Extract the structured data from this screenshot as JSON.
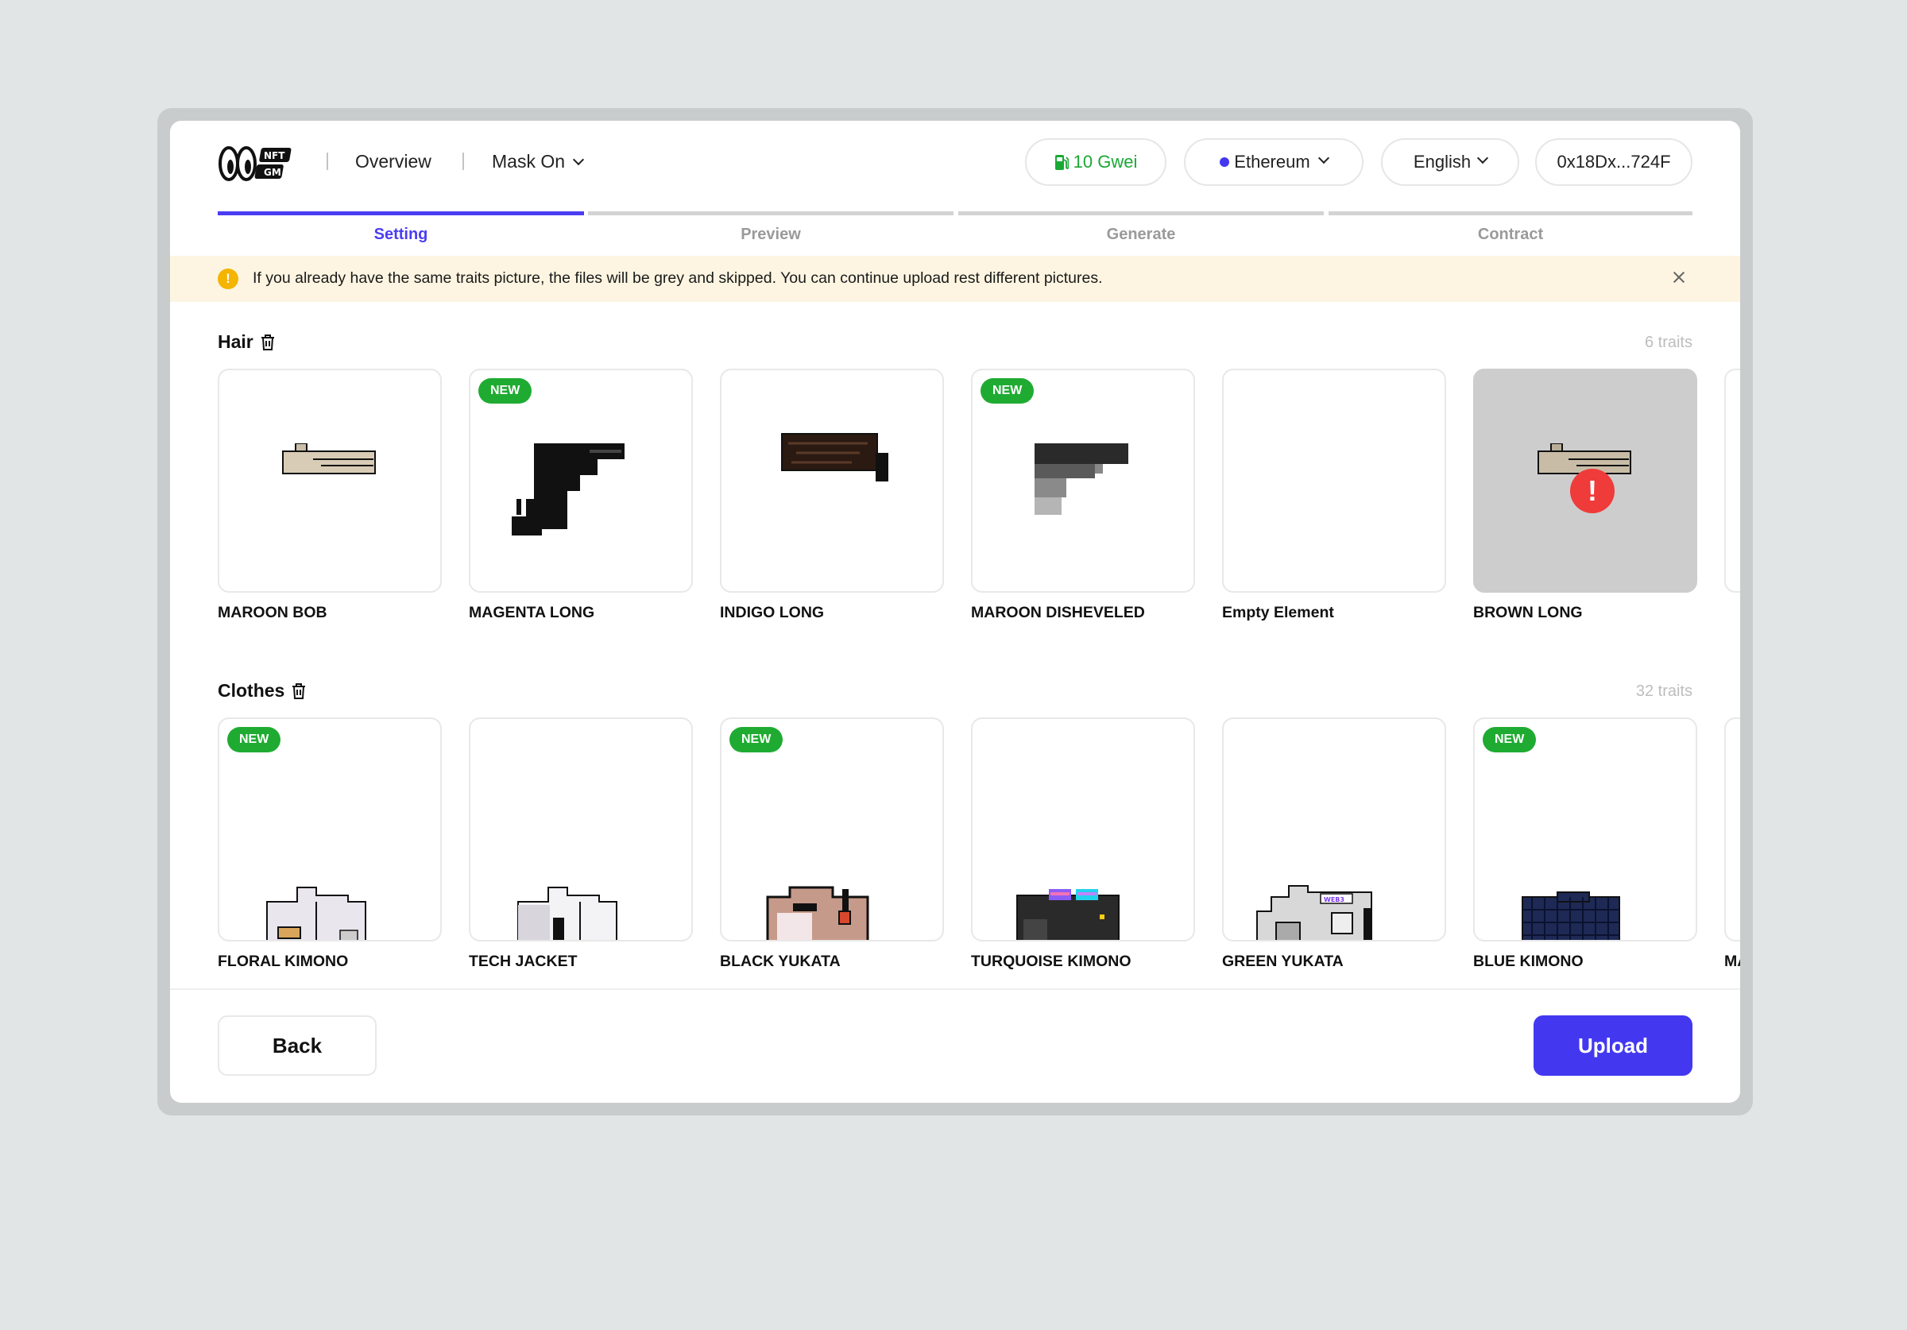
{
  "header": {
    "logo_text": "NFT GM",
    "nav": {
      "overview": "Overview",
      "project": "Mask On"
    },
    "gas": "10 Gwei",
    "network": "Ethereum",
    "language": "English",
    "wallet": "0x18Dx...724F"
  },
  "steps": [
    {
      "label": "Setting",
      "active": true
    },
    {
      "label": "Preview",
      "active": false
    },
    {
      "label": "Generate",
      "active": false
    },
    {
      "label": "Contract",
      "active": false
    }
  ],
  "notice": {
    "text": "If you already have the same traits picture,  the files will be grey and skipped. You can continue upload rest different pictures."
  },
  "sections": [
    {
      "title": "Hair",
      "count": "6 traits",
      "items": [
        {
          "name": "MAROON BOB",
          "badge": ""
        },
        {
          "name": "MAGENTA LONG",
          "badge": "NEW"
        },
        {
          "name": "INDIGO LONG",
          "badge": ""
        },
        {
          "name": "MAROON DISHEVELED",
          "badge": "NEW"
        },
        {
          "name": "Empty Element",
          "badge": ""
        },
        {
          "name": "BROWN LONG",
          "badge": "",
          "duplicate": true
        }
      ]
    },
    {
      "title": "Clothes",
      "count": "32 traits",
      "items": [
        {
          "name": "FLORAL KIMONO",
          "badge": "NEW"
        },
        {
          "name": "TECH JACKET",
          "badge": ""
        },
        {
          "name": "BLACK YUKATA",
          "badge": "NEW"
        },
        {
          "name": "TURQUOISE KIMONO",
          "badge": ""
        },
        {
          "name": "GREEN YUKATA",
          "badge": ""
        },
        {
          "name": "BLUE KIMONO",
          "badge": "NEW"
        },
        {
          "name": "MA",
          "badge": ""
        }
      ]
    }
  ],
  "footer": {
    "back": "Back",
    "upload": "Upload"
  },
  "colors": {
    "accent": "#4338f0",
    "new_badge": "#1fab32",
    "error": "#ef3b39",
    "warning": "#f4b400",
    "notice_bg": "#fdf5e1"
  }
}
